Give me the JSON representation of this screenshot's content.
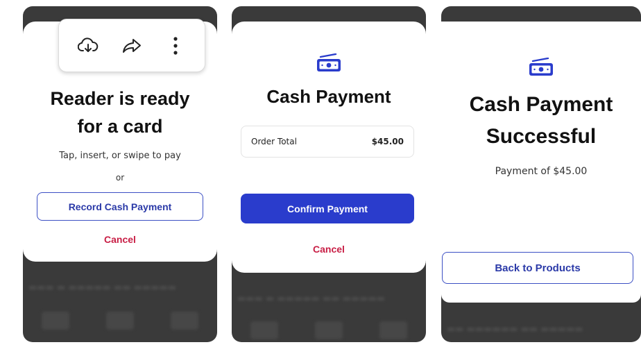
{
  "screens": [
    {
      "title_line1": "Reader is ready",
      "title_line2": "for a card",
      "subtitle": "Tap, insert, or swipe to pay",
      "or_text": "or",
      "record_cash_label": "Record Cash Payment",
      "cancel_label": "Cancel",
      "popover": {
        "icons": [
          "cloud-download-icon",
          "share-arrow-icon",
          "more-vertical-icon"
        ]
      }
    },
    {
      "title": "Cash Payment",
      "order_label": "Order Total",
      "order_amount": "$45.00",
      "confirm_label": "Confirm Payment",
      "cancel_label": "Cancel"
    },
    {
      "title_line1": "Cash Payment",
      "title_line2": "Successful",
      "payment_text": "Payment of $45.00",
      "back_label": "Back to Products"
    }
  ],
  "colors": {
    "accent": "#2a3ccc",
    "cancel": "#c81e45",
    "backdrop": "#3a3a3a"
  }
}
